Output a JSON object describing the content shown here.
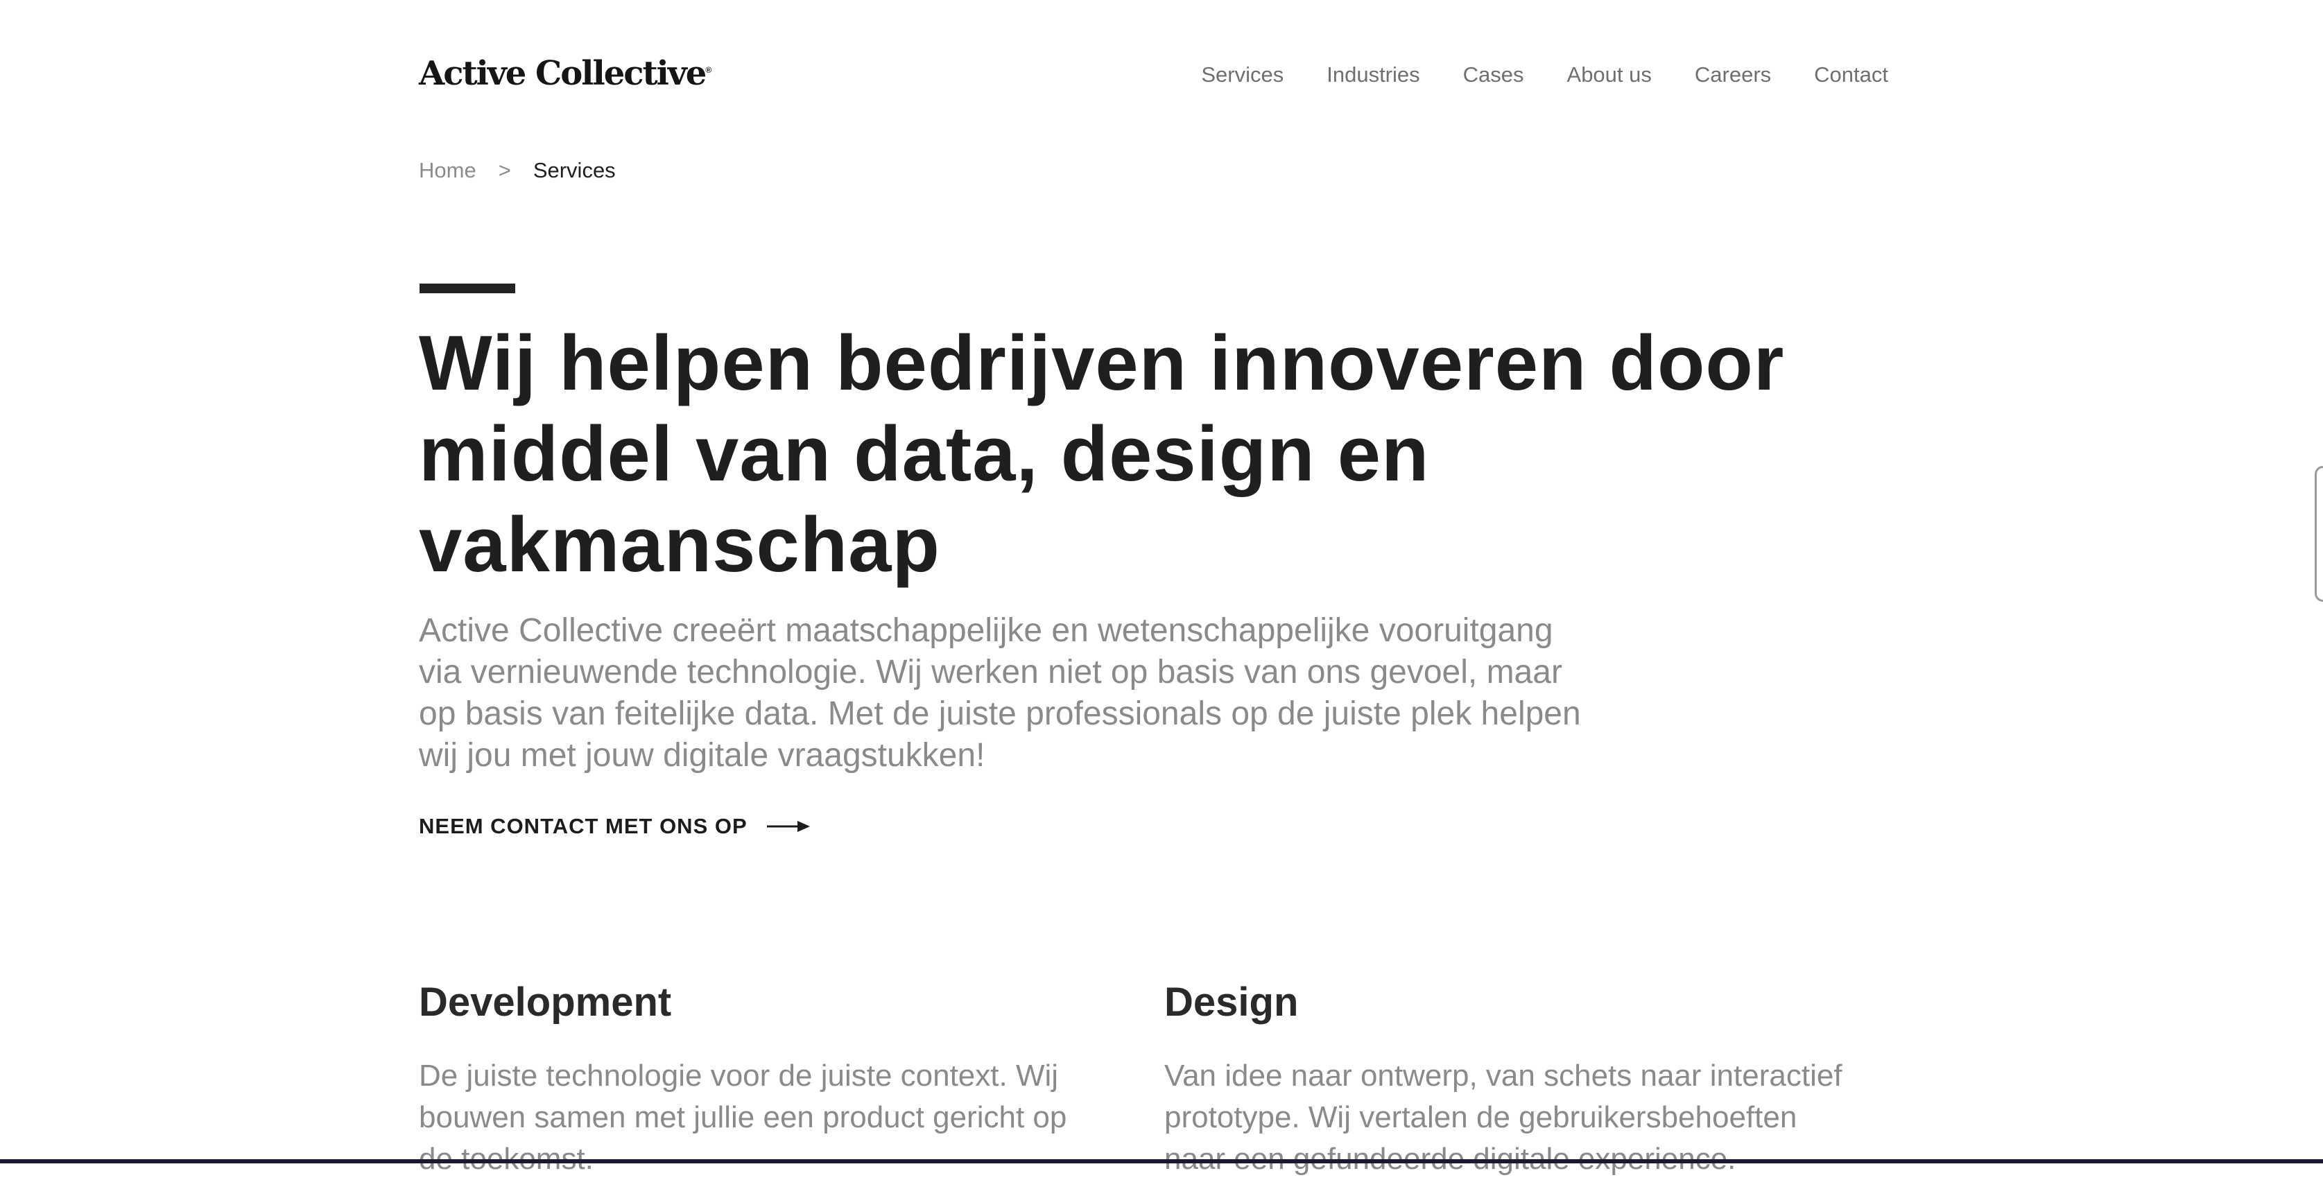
{
  "header": {
    "logo_text": "Active Collective",
    "logo_mark": "®",
    "nav": [
      "Services",
      "Industries",
      "Cases",
      "About us",
      "Careers",
      "Contact"
    ]
  },
  "breadcrumb": {
    "home": "Home",
    "separator": ">",
    "current": "Services"
  },
  "hero": {
    "title": "Wij helpen bedrijven innoveren door middel van data, design en vakmanschap",
    "lead": "Active Collective creeërt maatschappelijke en wetenschappelijke vooruitgang via vernieuwende technologie. Wij werken niet op basis van ons gevoel, maar op basis van feitelijke data. Met de juiste professionals op de juiste plek helpen wij jou met jouw digitale vraagstukken!",
    "cta_label": "NEEM CONTACT MET ONS OP",
    "cta_icon": "arrow-right-icon"
  },
  "services": {
    "development": {
      "title": "Development",
      "text": "De juiste technologie voor de juiste context. Wij bouwen samen met jullie een product gericht op de toekomst."
    },
    "design": {
      "title": "Design",
      "text": "Van idee naar ontwerp, van schets naar interactief prototype. Wij vertalen de gebruikersbehoeften naar een gefundeerde digitale experience."
    }
  },
  "colors": {
    "text_dark": "#1f1f1f",
    "text_muted": "#8a8a8a",
    "nav_text": "#6f6f6f",
    "background": "#ffffff"
  }
}
